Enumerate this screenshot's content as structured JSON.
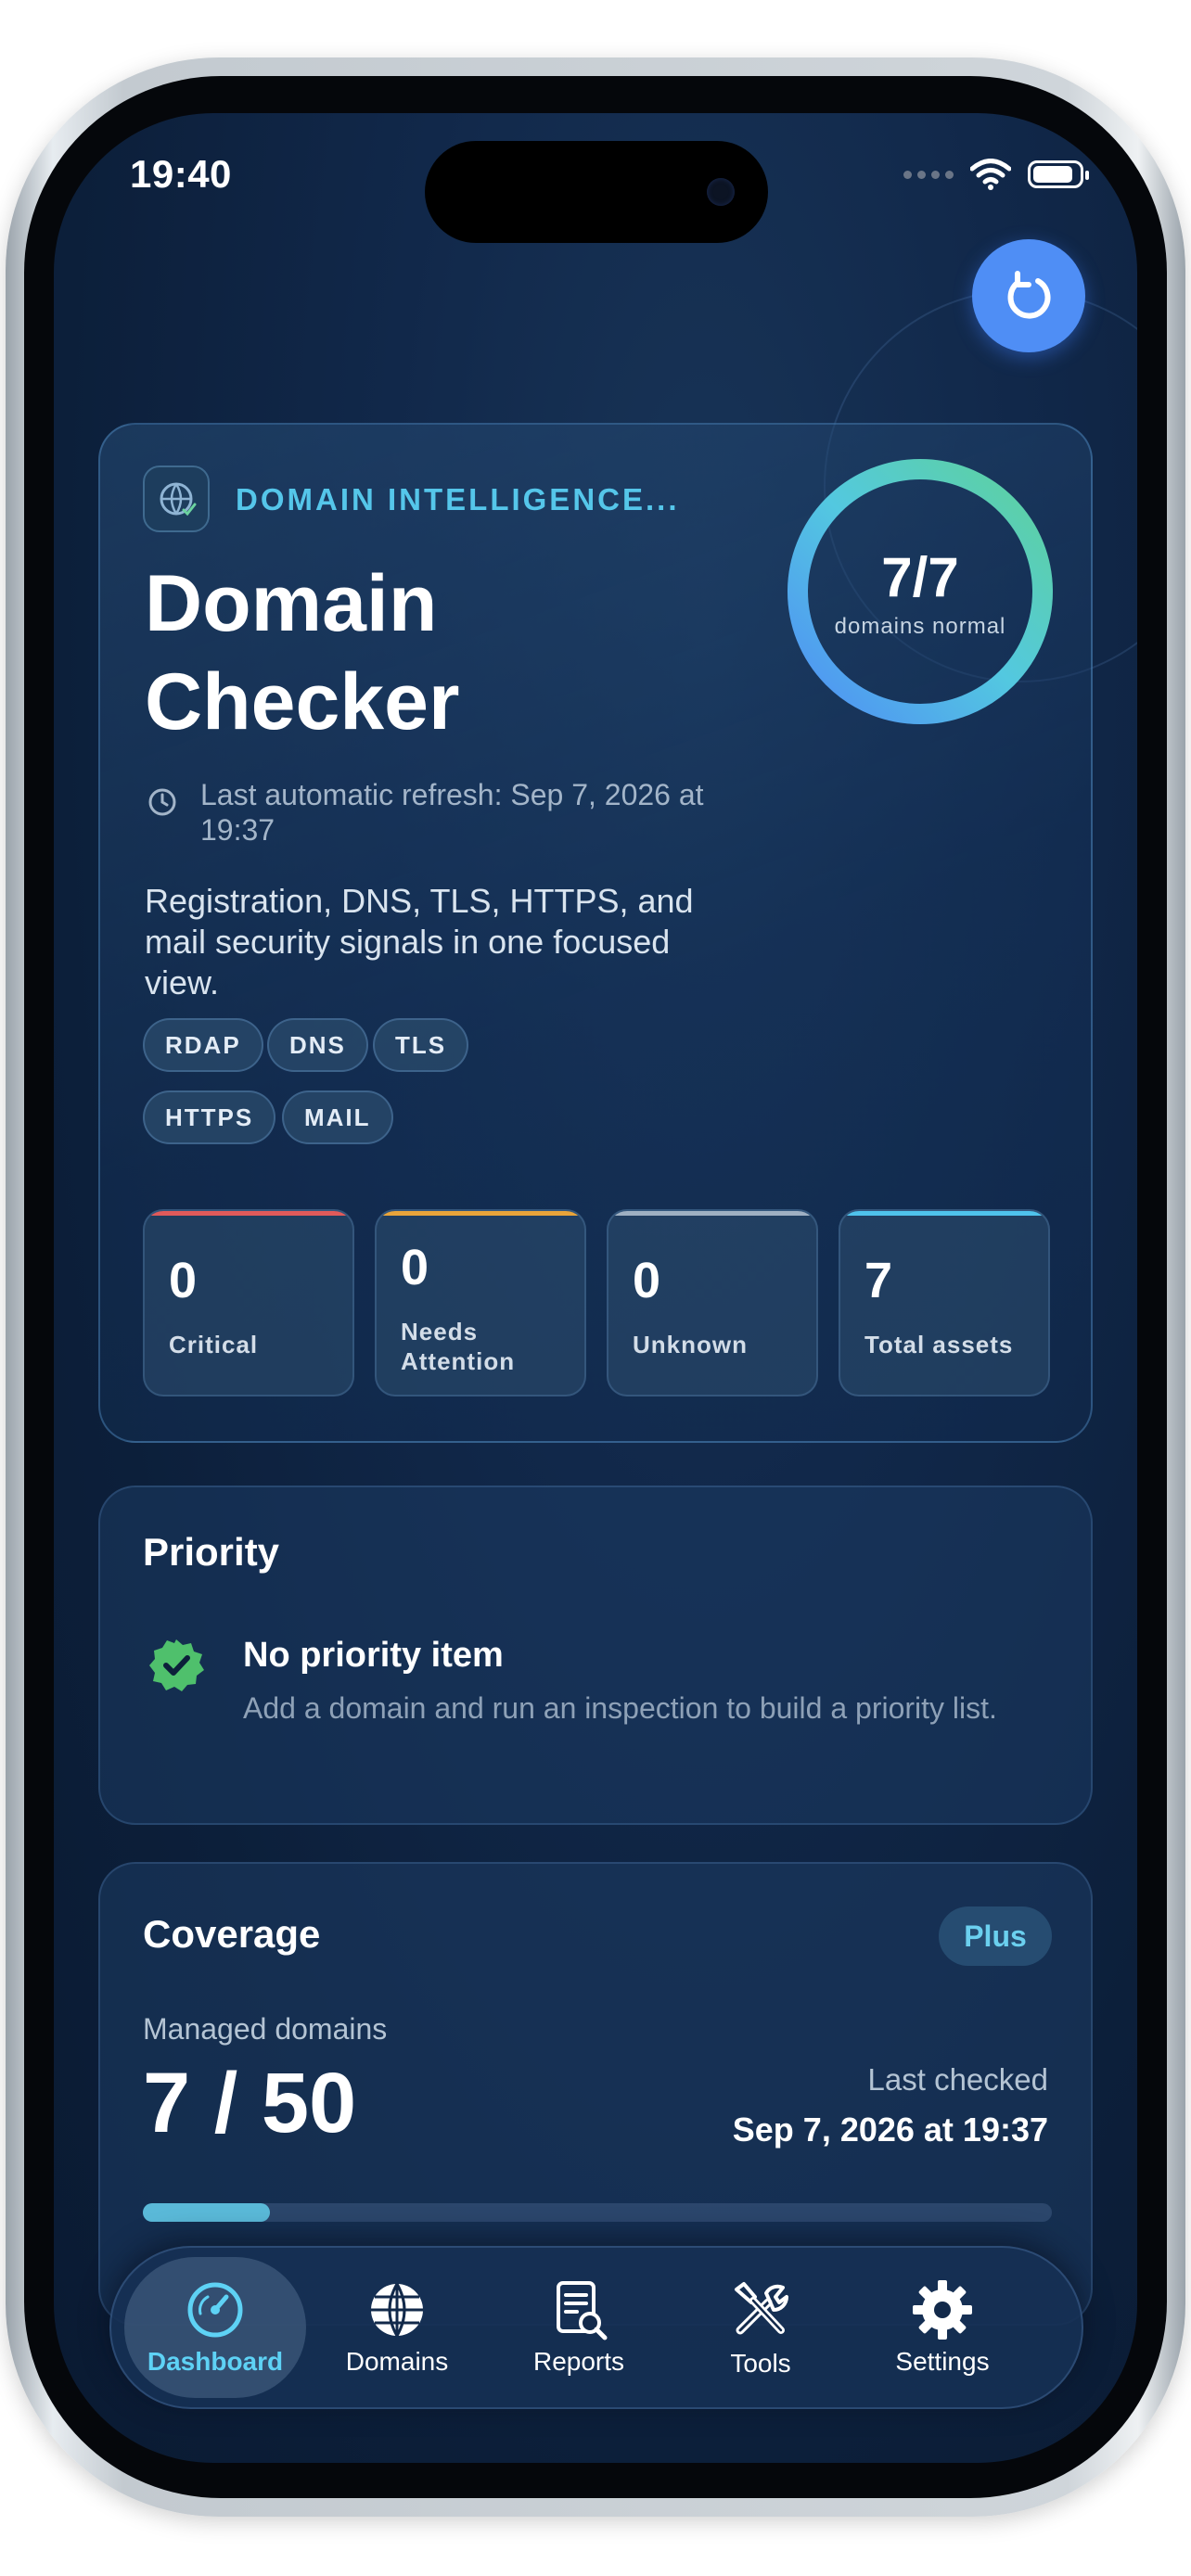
{
  "status_bar": {
    "time": "19:40"
  },
  "hero": {
    "eyebrow": "DOMAIN INTELLIGENCE...",
    "title": "Domain Checker",
    "last_refresh": "Last automatic refresh: Sep 7, 2026 at 19:37",
    "description": "Registration, DNS, TLS, HTTPS, and mail security signals in one focused view.",
    "chips": [
      "RDAP",
      "DNS",
      "TLS",
      "HTTPS",
      "MAIL"
    ],
    "ring": {
      "value": "7/7",
      "label": "domains normal",
      "fraction": 1.0
    },
    "stats": [
      {
        "value": "0",
        "label": "Critical",
        "color": "#e05a5a"
      },
      {
        "value": "0",
        "label": "Needs Attention",
        "color": "#e9a43a"
      },
      {
        "value": "0",
        "label": "Unknown",
        "color": "#9fb0c2"
      },
      {
        "value": "7",
        "label": "Total assets",
        "color": "#4fc3ec"
      }
    ]
  },
  "priority": {
    "title": "Priority",
    "item_title": "No priority item",
    "item_subtitle": "Add a domain and run an inspection to build a priority list."
  },
  "coverage": {
    "title": "Coverage",
    "badge": "Plus",
    "managed_label": "Managed domains",
    "managed_value": "7 / 50",
    "managed_fraction": 0.14,
    "last_checked_label": "Last checked",
    "last_checked_value": "Sep 7, 2026 at 19:37"
  },
  "tabbar": {
    "tabs": [
      {
        "label": "Dashboard",
        "icon": "gauge-icon",
        "active": true
      },
      {
        "label": "Domains",
        "icon": "globe-icon",
        "active": false
      },
      {
        "label": "Reports",
        "icon": "report-icon",
        "active": false
      },
      {
        "label": "Tools",
        "icon": "tools-icon",
        "active": false
      },
      {
        "label": "Settings",
        "icon": "gear-icon",
        "active": false
      }
    ]
  },
  "colors": {
    "accent": "#4f8ef5",
    "accent_cyan": "#55c6ea",
    "ring_start": "#4f8ef5",
    "ring_end": "#5ed29a",
    "success": "#4fc06c"
  }
}
